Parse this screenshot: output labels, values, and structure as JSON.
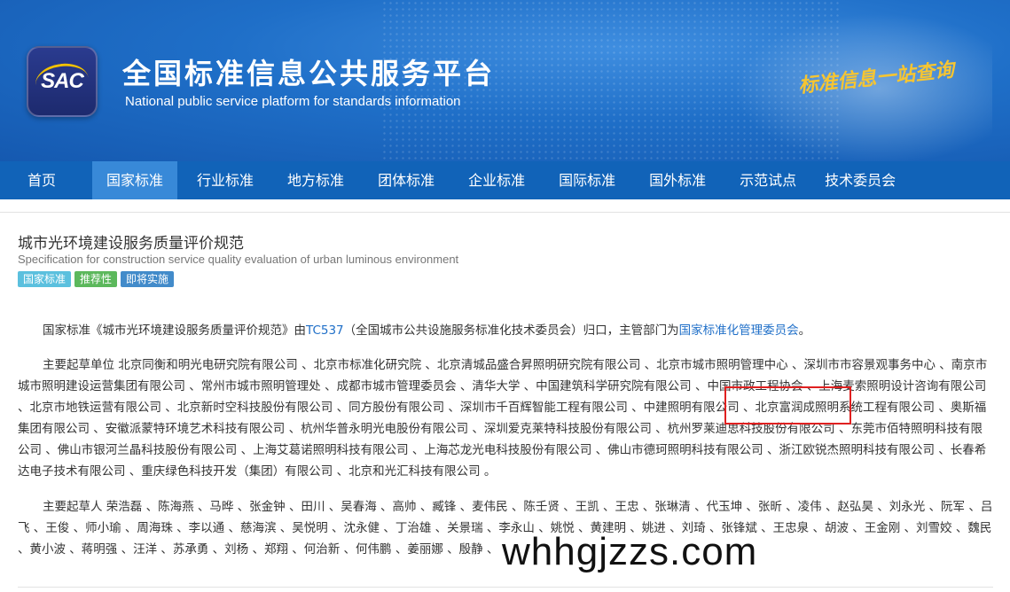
{
  "header": {
    "logo_text": "SAC",
    "title": "全国标准信息公共服务平台",
    "subtitle": "National public service platform  for standards information",
    "slogan": "标准信息一站查询"
  },
  "nav": {
    "items": [
      {
        "label": "首页",
        "active": false
      },
      {
        "label": "国家标准",
        "active": true
      },
      {
        "label": "行业标准",
        "active": false
      },
      {
        "label": "地方标准",
        "active": false
      },
      {
        "label": "团体标准",
        "active": false
      },
      {
        "label": "企业标准",
        "active": false
      },
      {
        "label": "国际标准",
        "active": false
      },
      {
        "label": "国外标准",
        "active": false
      },
      {
        "label": "示范试点",
        "active": false
      },
      {
        "label": "技术委员会",
        "active": false
      }
    ]
  },
  "standard": {
    "title_cn": "城市光环境建设服务质量评价规范",
    "title_en": "Specification for construction service quality evaluation of urban luminous environment",
    "badges": [
      "国家标准",
      "推荐性",
      "即将实施"
    ]
  },
  "intro": {
    "prefix": "国家标准《城市光环境建设服务质量评价规范》由",
    "tc_link": "TC537",
    "middle": "（全国城市公共设施服务标准化技术委员会）归口，主管部门为",
    "dept_link": "国家标准化管理委员会",
    "suffix": "。"
  },
  "drafting_units": {
    "before_highlight": "主要起草单位 北京同衡和明光电研究院有限公司 、北京市标准化研究院 、北京清城品盛合昇照明研究院有限公司 、北京市城市照明管理中心 、深圳市市容景观事务中心 、南京市城市照明建设运营集团有限公司 、常州市城市照明管理处 、成都市城市管理委员会 、清华大学 、中国建筑科学研究院有限公司 、中国市政工程协会 、上海麦索照明设计咨询有限公司 、北京市地铁运营有限公司 、北京新时空科技股份有限公司 、同方股份有限公司 、深圳市千百辉智能工程有限公司 、",
    "highlight": "中建照明有限公司",
    "after_highlight": " 、北京富润成照明系统工程有限公司 、奥斯福集团有限公司 、安徽派蒙特环境艺术科技有限公司 、杭州华普永明光电股份有限公司 、深圳爱克莱特科技股份有限公司 、杭州罗莱迪思科技股份有限公司 、东莞市佰特照明科技有限公司 、佛山市银河兰晶科技股份有限公司 、上海艾葛诺照明科技有限公司 、上海芯龙光电科技股份有限公司 、佛山市德珂照明科技有限公司 、浙江欧锐杰照明科技有限公司 、长春希达电子技术有限公司 、重庆绿色科技开发（集团）有限公司 、北京和光汇科技有限公司 。"
  },
  "drafters": {
    "text": "主要起草人 荣浩磊 、陈海燕 、马晔 、张金钟 、田川 、吴春海 、高帅 、臧锋 、麦伟民 、陈壬贤 、王凯 、王忠 、张琳清 、代玉坤 、张昕 、凌伟 、赵弘昊 、刘永光 、阮军 、吕飞 、王俊 、师小瑜 、周海珠 、李以通 、慈海滨 、吴悦明 、沈永健 、丁治雄 、关景瑞 、李永山 、姚悦 、黄建明 、姚进 、刘琦 、张锋斌 、王忠泉 、胡波 、王金刚 、刘雪姣 、魏民 、黄小波 、蒋明强 、汪洋 、苏承勇 、刘杨 、郑翔 、何治新 、何伟鹏 、姜丽娜 、殷静 、"
  },
  "watermark": "whhgjzzs.com"
}
